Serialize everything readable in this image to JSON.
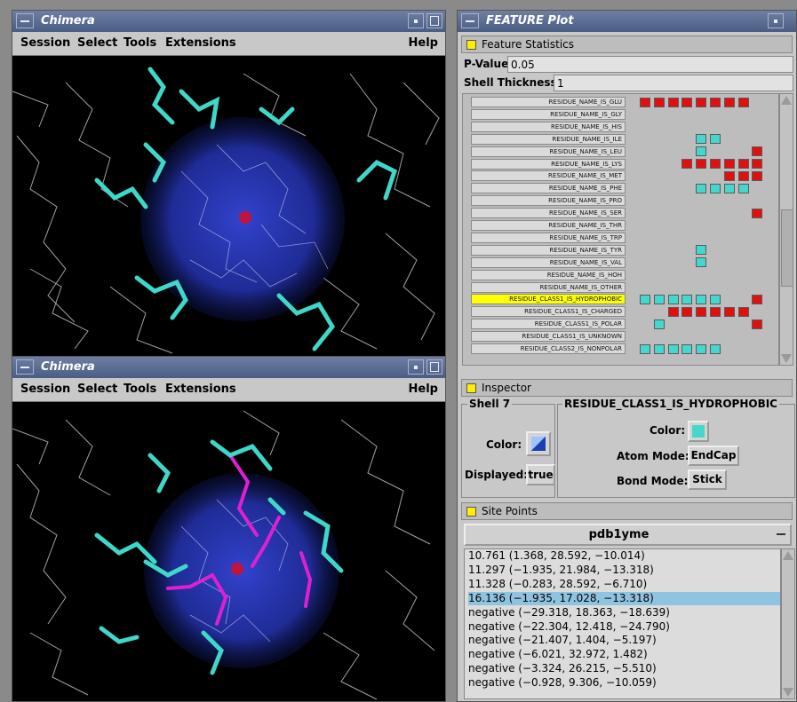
{
  "chimera_top": {
    "title": "Chimera",
    "menu": [
      "Session",
      "Select",
      "Tools",
      "Extensions"
    ],
    "help": "Help"
  },
  "chimera_bottom": {
    "title": "Chimera",
    "menu": [
      "Session",
      "Select",
      "Tools",
      "Extensions"
    ],
    "help": "Help"
  },
  "feature": {
    "title": "FEATURE Plot",
    "stats_header": "Feature Statistics",
    "pvalue_label": "P-Value:",
    "pvalue": "0.05",
    "shell_label": "Shell Thickness:",
    "shell_value": "1",
    "rows": [
      {
        "label": "RESIDUE_NAME_IS_GLU",
        "cells": [
          "r",
          "r",
          "r",
          "r",
          "r",
          "r",
          "r",
          "r",
          "",
          ""
        ]
      },
      {
        "label": "RESIDUE_NAME_IS_GLY",
        "cells": [
          "",
          "",
          "",
          "",
          "",
          "",
          "",
          "",
          "",
          ""
        ]
      },
      {
        "label": "RESIDUE_NAME_IS_HIS",
        "cells": [
          "",
          "",
          "",
          "",
          "",
          "",
          "",
          "",
          "",
          ""
        ]
      },
      {
        "label": "RESIDUE_NAME_IS_ILE",
        "cells": [
          "",
          "",
          "",
          "",
          "c",
          "c",
          "",
          "",
          "",
          ""
        ]
      },
      {
        "label": "RESIDUE_NAME_IS_LEU",
        "cells": [
          "",
          "",
          "",
          "",
          "c",
          "",
          "",
          "",
          "r",
          ""
        ]
      },
      {
        "label": "RESIDUE_NAME_IS_LYS",
        "cells": [
          "",
          "",
          "",
          "r",
          "r",
          "r",
          "r",
          "r",
          "r",
          ""
        ]
      },
      {
        "label": "RESIDUE_NAME_IS_MET",
        "cells": [
          "",
          "",
          "",
          "",
          "",
          "",
          "r",
          "r",
          "r",
          ""
        ]
      },
      {
        "label": "RESIDUE_NAME_IS_PHE",
        "cells": [
          "",
          "",
          "",
          "",
          "c",
          "c",
          "c",
          "c",
          "",
          ""
        ]
      },
      {
        "label": "RESIDUE_NAME_IS_PRO",
        "cells": [
          "",
          "",
          "",
          "",
          "",
          "",
          "",
          "",
          "",
          ""
        ]
      },
      {
        "label": "RESIDUE_NAME_IS_SER",
        "cells": [
          "",
          "",
          "",
          "",
          "",
          "",
          "",
          "",
          "r",
          ""
        ]
      },
      {
        "label": "RESIDUE_NAME_IS_THR",
        "cells": [
          "",
          "",
          "",
          "",
          "",
          "",
          "",
          "",
          "",
          ""
        ]
      },
      {
        "label": "RESIDUE_NAME_IS_TRP",
        "cells": [
          "",
          "",
          "",
          "",
          "",
          "",
          "",
          "",
          "",
          ""
        ]
      },
      {
        "label": "RESIDUE_NAME_IS_TYR",
        "cells": [
          "",
          "",
          "",
          "",
          "c",
          "",
          "",
          "",
          "",
          ""
        ]
      },
      {
        "label": "RESIDUE_NAME_IS_VAL",
        "cells": [
          "",
          "",
          "",
          "",
          "c",
          "",
          "",
          "",
          "",
          ""
        ]
      },
      {
        "label": "RESIDUE_NAME_IS_HOH",
        "cells": [
          "",
          "",
          "",
          "",
          "",
          "",
          "",
          "",
          "",
          ""
        ]
      },
      {
        "label": "RESIDUE_NAME_IS_OTHER",
        "cells": [
          "",
          "",
          "",
          "",
          "",
          "",
          "",
          "",
          "",
          ""
        ]
      },
      {
        "label": "RESIDUE_CLASS1_IS_HYDROPHOBIC",
        "cells": [
          "c",
          "c",
          "c",
          "c",
          "c",
          "c",
          "",
          "",
          "r",
          ""
        ],
        "selected": true
      },
      {
        "label": "RESIDUE_CLASS1_IS_CHARGED",
        "cells": [
          "",
          "",
          "r",
          "r",
          "r",
          "r",
          "r",
          "r",
          "",
          ""
        ]
      },
      {
        "label": "RESIDUE_CLASS1_IS_POLAR",
        "cells": [
          "",
          "c",
          "",
          "",
          "",
          "",
          "",
          "",
          "r",
          ""
        ]
      },
      {
        "label": "RESIDUE_CLASS1_IS_UNKNOWN",
        "cells": [
          "",
          "",
          "",
          "",
          "",
          "",
          "",
          "",
          "",
          ""
        ]
      },
      {
        "label": "RESIDUE_CLASS2_IS_NONPOLAR",
        "cells": [
          "c",
          "c",
          "c",
          "c",
          "c",
          "c",
          "",
          "",
          "",
          ""
        ]
      }
    ],
    "inspector_header": "Inspector",
    "shell_group": "Shell 7",
    "color_label": "Color:",
    "displayed_label": "Displayed:",
    "displayed_value": "true",
    "feature_group": "RESIDUE_CLASS1_IS_HYDROPHOBIC",
    "fcolor_label": "Color:",
    "atom_mode_label": "Atom Mode:",
    "atom_mode": "EndCap",
    "bond_mode_label": "Bond Mode:",
    "bond_mode": "Stick",
    "site_points_header": "Site Points",
    "site_model": "pdb1yme",
    "site_points": [
      "10.761 (1.368, 28.592, −10.014)",
      "11.297 (−1.935, 21.984, −13.318)",
      "11.328 (−0.283, 28.592, −6.710)",
      "16.136 (−1.935, 17.028, −13.318)",
      "negative (−29.318, 18.363, −18.639)",
      "negative (−22.304, 12.418, −24.790)",
      "negative (−21.407, 1.404, −5.197)",
      "negative (−6.021, 32.972, 1.482)",
      "negative (−3.324, 26.215, −5.510)",
      "negative (−0.928, 9.306, −10.059)"
    ],
    "selected_site_index": 3
  },
  "colors": {
    "hydrophobic_cyan": "#44d8cc",
    "charged_red": "#e01010",
    "selection_yellow": "#ffff00",
    "selection_row": "#8fc4e0",
    "magenta": "#e020d0",
    "sphere_blue": "#2a3bc8"
  }
}
